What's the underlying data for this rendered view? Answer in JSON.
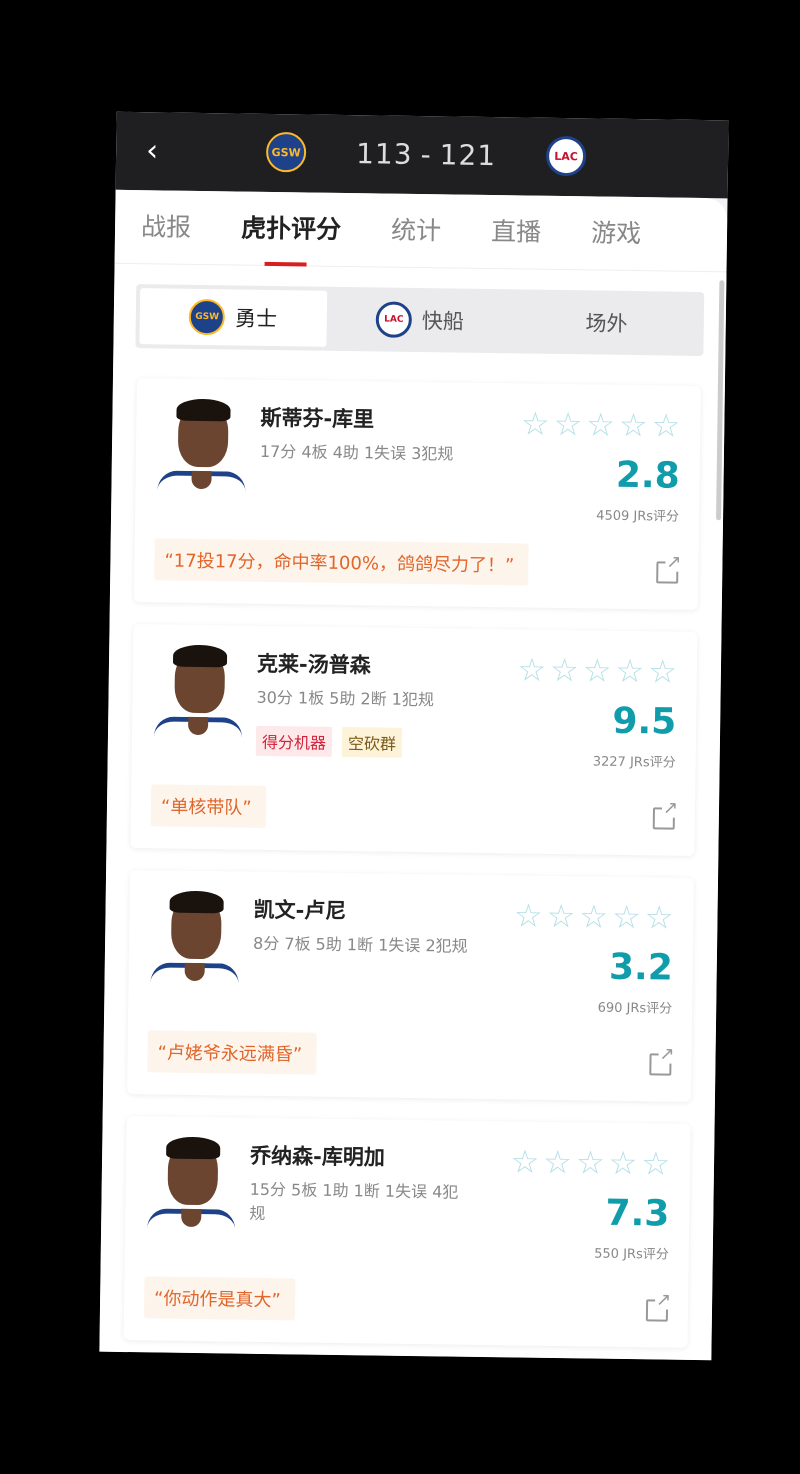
{
  "header": {
    "score_home": "113",
    "score_sep": "-",
    "score_away": "121",
    "home_logo_text": "GSW",
    "away_logo_text": "LAC"
  },
  "tabs": [
    {
      "label": "战报"
    },
    {
      "label": "虎扑评分"
    },
    {
      "label": "统计"
    },
    {
      "label": "直播"
    },
    {
      "label": "游戏"
    }
  ],
  "team_segments": [
    {
      "label": "勇士",
      "logo": "GSW"
    },
    {
      "label": "快船",
      "logo": "LAC"
    },
    {
      "label": "场外"
    }
  ],
  "players": [
    {
      "name": "斯蒂芬-库里",
      "stats": "17分 4板 4助 1失误 3犯规",
      "rating": "2.8",
      "count": "4509 JRs评分",
      "quote": "“17投17分，命中率100%，鸽鸽尽力了！”",
      "tags": []
    },
    {
      "name": "克莱-汤普森",
      "stats": "30分 1板 5助 2断 1犯规",
      "rating": "9.5",
      "count": "3227 JRs评分",
      "quote": "“单核带队”",
      "tags": [
        "得分机器",
        "空砍群"
      ]
    },
    {
      "name": "凯文-卢尼",
      "stats": "8分 7板 5助 1断 1失误 2犯规",
      "rating": "3.2",
      "count": "690 JRs评分",
      "quote": "“卢姥爷永远满昏”",
      "tags": []
    },
    {
      "name": "乔纳森-库明加",
      "stats": "15分 5板 1助 1断 1失误 4犯规",
      "rating": "7.3",
      "count": "550 JRs评分",
      "quote": "“你动作是真大”",
      "tags": []
    }
  ],
  "colors": {
    "accent_red": "#d81e1e",
    "rating_teal": "#109cab",
    "quote_orange": "#e0662b"
  }
}
